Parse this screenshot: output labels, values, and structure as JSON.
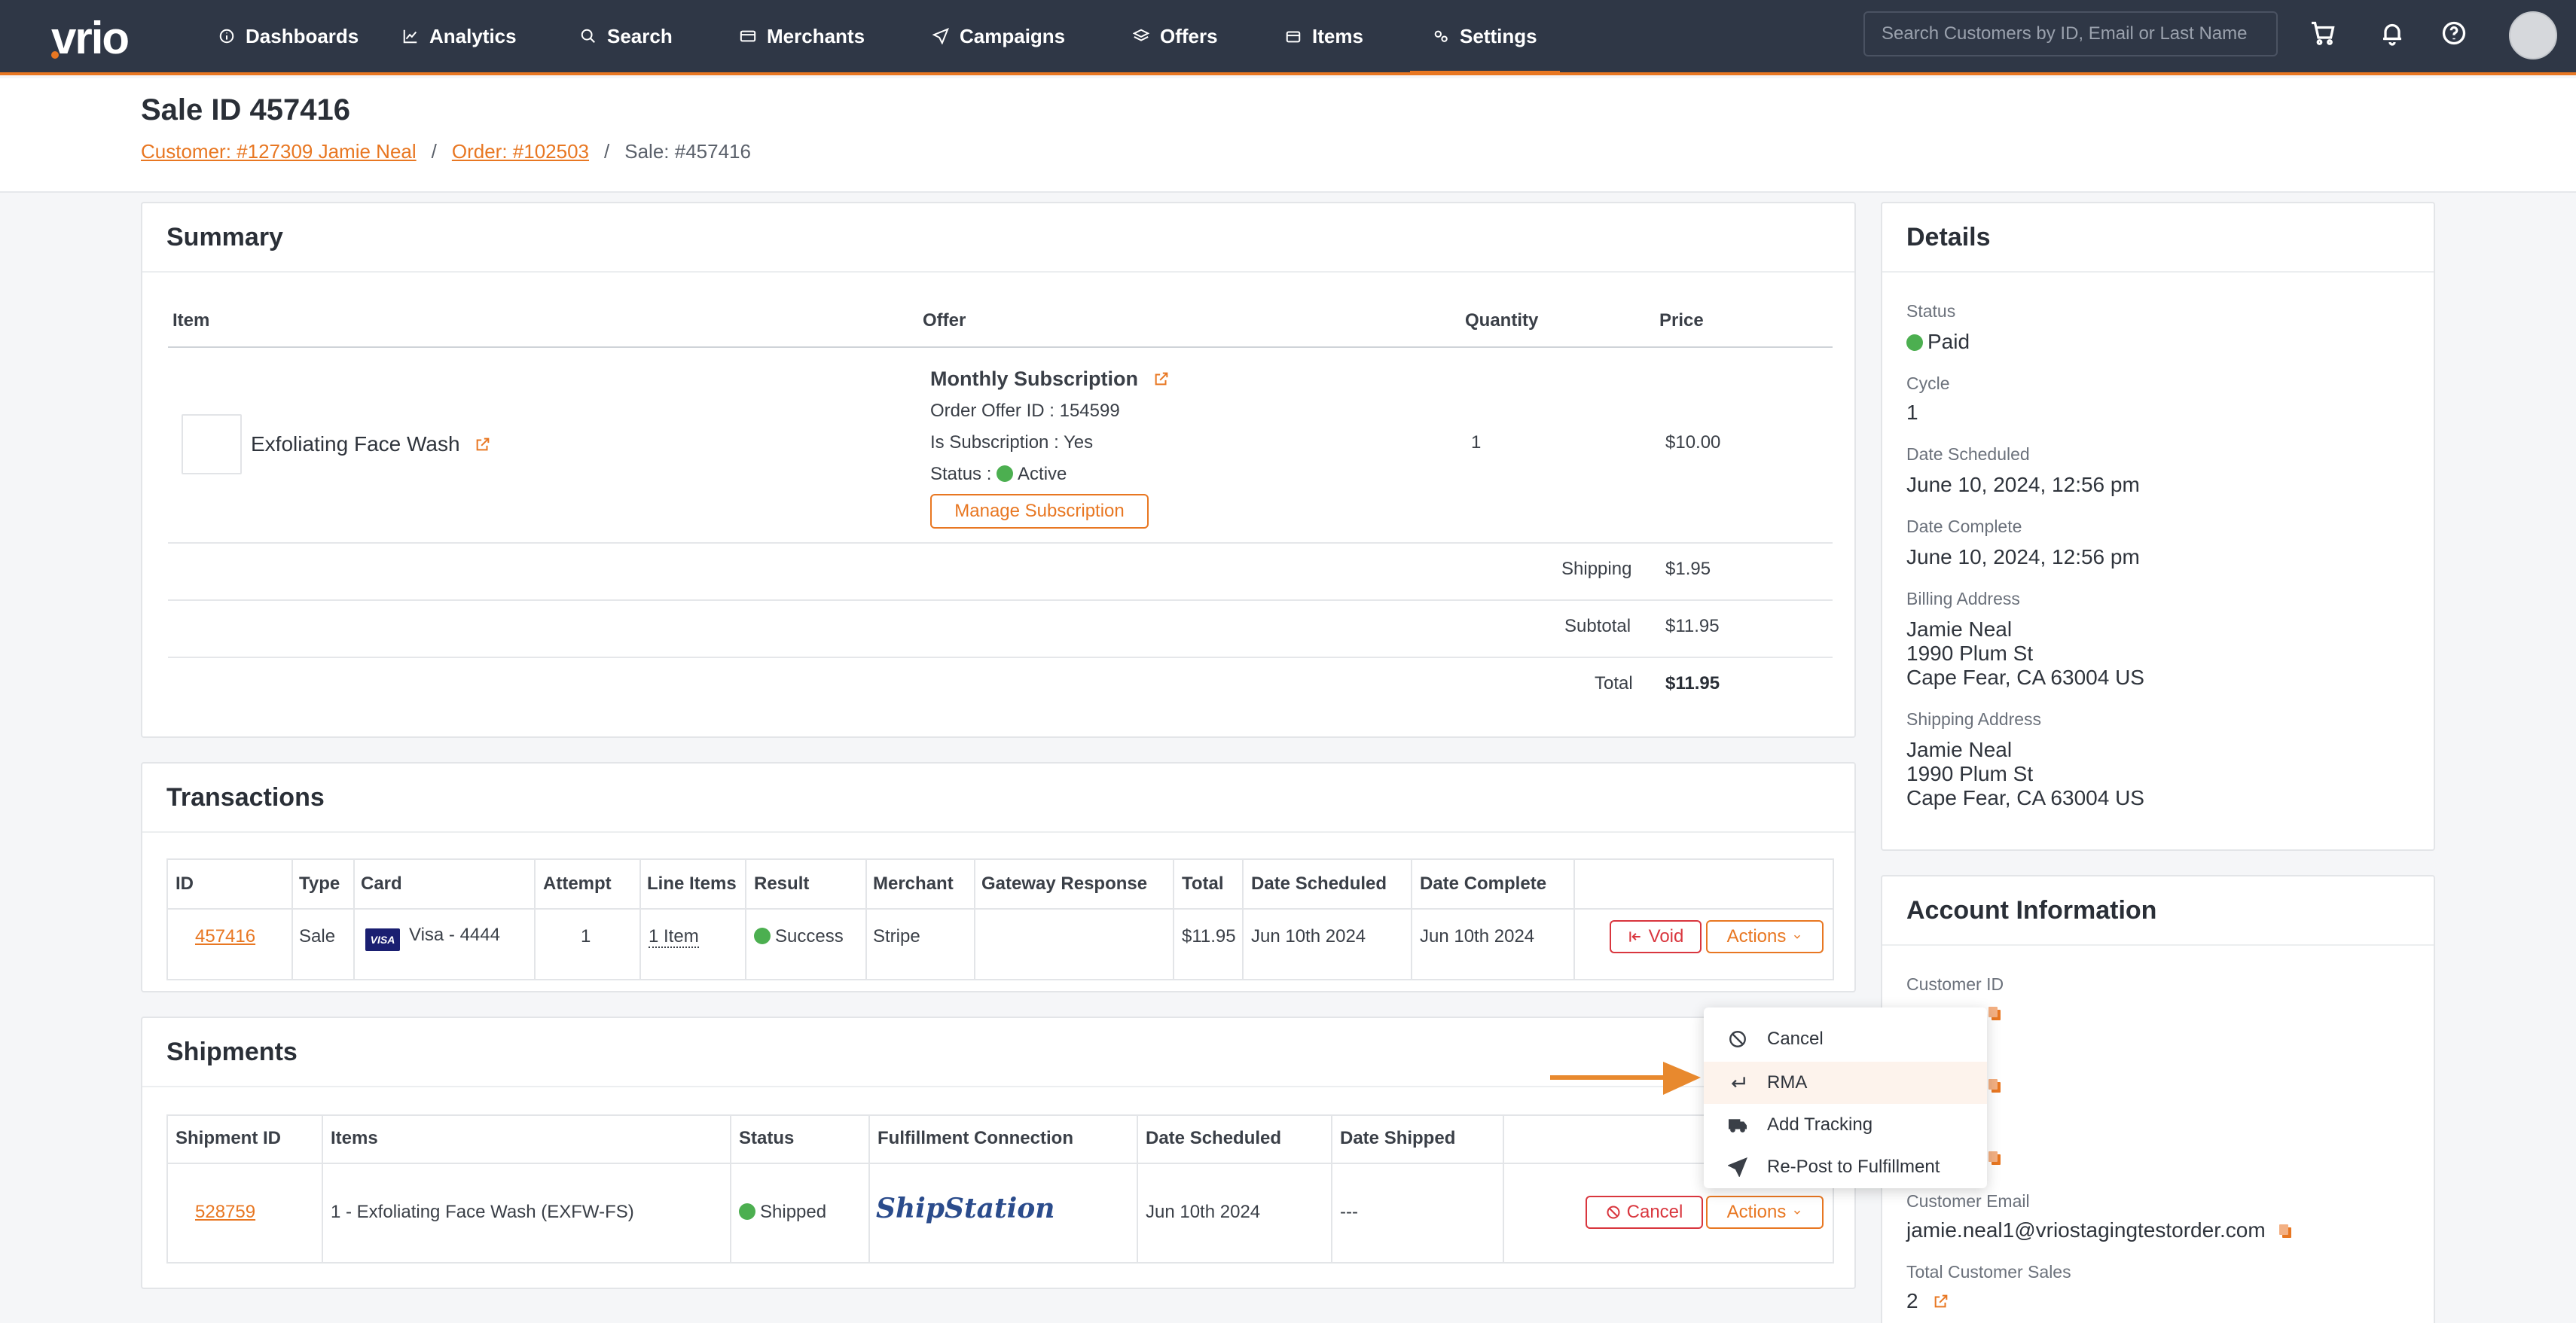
{
  "nav": {
    "logo": "vrio",
    "items": [
      {
        "label": "Dashboards",
        "icon": "info-icon"
      },
      {
        "label": "Analytics",
        "icon": "chart-line-icon"
      },
      {
        "label": "Search",
        "icon": "search-icon"
      },
      {
        "label": "Merchants",
        "icon": "credit-card-icon"
      },
      {
        "label": "Campaigns",
        "icon": "paper-plane-icon"
      },
      {
        "label": "Offers",
        "icon": "layers-icon"
      },
      {
        "label": "Items",
        "icon": "box-icon"
      },
      {
        "label": "Settings",
        "icon": "gears-icon"
      }
    ],
    "search_placeholder": "Search Customers by ID, Email or Last Name",
    "accent": "#e87722",
    "bg": "#2f3746"
  },
  "header": {
    "title": "Sale ID 457416",
    "breadcrumb": {
      "customer": "Customer: #127309 Jamie Neal",
      "order": "Order: #102503",
      "sale": "Sale: #457416",
      "sep": "/"
    }
  },
  "summary": {
    "title": "Summary",
    "columns": {
      "item": "Item",
      "offer": "Offer",
      "quantity": "Quantity",
      "price": "Price"
    },
    "row": {
      "item_name": "Exfoliating Face Wash",
      "offer_name": "Monthly Subscription",
      "order_offer_id": "Order Offer ID : 154599",
      "is_subscription": "Is Subscription : Yes",
      "status_label": "Status :",
      "status_value": "Active",
      "manage_button": "Manage Subscription",
      "quantity": "1",
      "price": "$10.00"
    },
    "totals": {
      "shipping_label": "Shipping",
      "shipping": "$1.95",
      "subtotal_label": "Subtotal",
      "subtotal": "$11.95",
      "total_label": "Total",
      "total": "$11.95"
    }
  },
  "transactions": {
    "title": "Transactions",
    "columns": [
      "ID",
      "Type",
      "Card",
      "Attempt",
      "Line Items",
      "Result",
      "Merchant",
      "Gateway Response",
      "Total",
      "Date Scheduled",
      "Date Complete"
    ],
    "row": {
      "id": "457416",
      "type": "Sale",
      "card_brand": "VISA",
      "card": "Visa - 4444",
      "attempt": "1",
      "line_items": "1 Item",
      "result": "Success",
      "merchant": "Stripe",
      "gateway_response": "",
      "total": "$11.95",
      "date_scheduled": "Jun 10th 2024",
      "date_complete": "Jun 10th 2024",
      "void_button": "Void",
      "actions_button": "Actions"
    }
  },
  "shipments": {
    "title": "Shipments",
    "columns": [
      "Shipment ID",
      "Items",
      "Status",
      "Fulfillment Connection",
      "Date Scheduled",
      "Date Shipped"
    ],
    "row": {
      "id": "528759",
      "items": "1 - Exfoliating Face Wash (EXFW-FS)",
      "status": "Shipped",
      "connection_logo": "ShipStation",
      "date_scheduled": "Jun 10th 2024",
      "date_shipped": "---",
      "cancel_button": "Cancel",
      "actions_button": "Actions"
    }
  },
  "actions_menu": {
    "items": [
      {
        "label": "Cancel",
        "icon": "ban-icon"
      },
      {
        "label": "RMA",
        "icon": "return-arrow-icon"
      },
      {
        "label": "Add Tracking",
        "icon": "truck-icon"
      },
      {
        "label": "Re-Post to Fulfillment",
        "icon": "send-icon"
      }
    ],
    "highlighted": "RMA"
  },
  "details": {
    "title": "Details",
    "status_label": "Status",
    "status": "Paid",
    "cycle_label": "Cycle",
    "cycle": "1",
    "date_scheduled_label": "Date Scheduled",
    "date_scheduled": "June 10, 2024, 12:56 pm",
    "date_complete_label": "Date Complete",
    "date_complete": "June 10, 2024, 12:56 pm",
    "billing_label": "Billing Address",
    "billing": {
      "name": "Jamie Neal",
      "street": "1990 Plum St",
      "city": "Cape Fear, CA 63004 US"
    },
    "shipping_label": "Shipping Address",
    "shipping": {
      "name": "Jamie Neal",
      "street": "1990 Plum St",
      "city": "Cape Fear, CA 63004 US"
    }
  },
  "account": {
    "title": "Account Information",
    "customer_id_label": "Customer ID",
    "customer_email_label": "Customer Email",
    "customer_email": "jamie.neal1@vriostagingtestorder.com",
    "total_sales_label": "Total Customer Sales",
    "total_sales": "2"
  }
}
